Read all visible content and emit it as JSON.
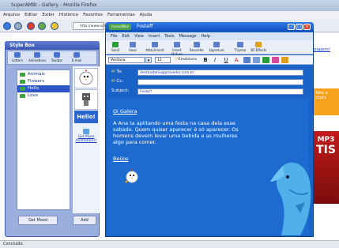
{
  "browser": {
    "title": "SuperAMBI - Gallery - Mozilla Firefox",
    "menu": [
      "Arquivo",
      "Editar",
      "Exibir",
      "Histórico",
      "Favoritos",
      "Ferramentas",
      "Ajuda"
    ],
    "url": "http://www.smile",
    "status": "Concluído",
    "right_link": "papers!",
    "ad_mp3": "MP3",
    "ad_big": "TIS",
    "ad_orange": "Take a chory"
  },
  "stylebox": {
    "title": "Style Box",
    "tools": [
      "Letters",
      "Animations",
      "Toolbar",
      "E-mail"
    ],
    "items": [
      {
        "label": "Animals",
        "selected": false
      },
      {
        "label": "Flowers",
        "selected": false
      },
      {
        "label": "Hello",
        "selected": true
      },
      {
        "label": "Love",
        "selected": false
      }
    ],
    "preview_hello": "Hello!",
    "get_more": "Get More Animations!",
    "btn_get_more": "Get Mood",
    "btn_add": "Add"
  },
  "compose": {
    "title": "Fosteff",
    "tag": "IncrediMail",
    "menu": [
      "File",
      "Edit",
      "View",
      "Insert",
      "Tools",
      "Message",
      "Help"
    ],
    "toolbar": [
      "Send",
      "Save",
      "Attachment",
      "Insert Picture",
      "Recorder",
      "Signature",
      "Trayme",
      "3D Effects"
    ],
    "font_name": "Verdana",
    "font_size": "12",
    "emoticons": "Emoticons",
    "format_buttons": [
      "B",
      "I",
      "U",
      "A"
    ],
    "to_label": "To:",
    "to_value": "destinatario@provedor.com.br",
    "cc_label": "Cc:",
    "cc_value": "",
    "subject_label": "Subject:",
    "subject_value": "Festa!!",
    "greeting": "Oi Galera",
    "body": "A Ana ta aplitando uma festa na casa dela esse sabado. Quem quiser aparecer é só aparecer. Os homens devem levar uma bebida e as mulheres algo para comer.",
    "signoff": "Beijos",
    "colors": {
      "bg": "#1d6bd0",
      "text": "#ffffff"
    }
  }
}
